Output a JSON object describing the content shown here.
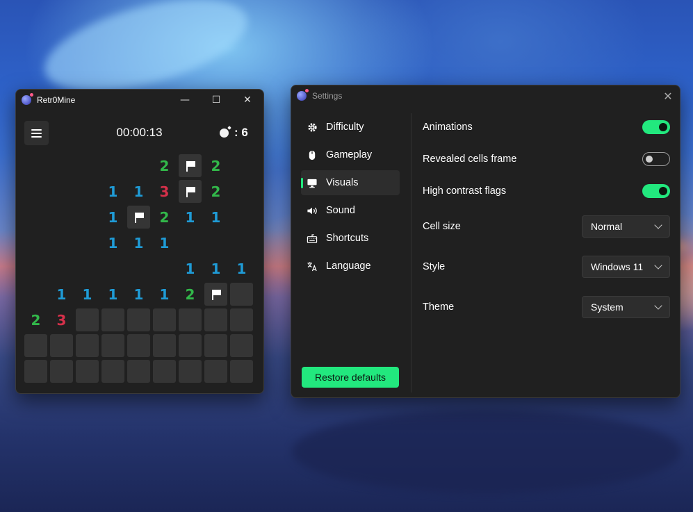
{
  "game_window": {
    "title": "Retr0Mine",
    "controls": {
      "minimize": "—",
      "maximize": "☐",
      "close": "✕"
    },
    "timer": "00:00:13",
    "mines_label": ": 6",
    "board": [
      [
        "",
        "",
        "",
        "",
        "",
        "2",
        "F",
        "2",
        ""
      ],
      [
        "",
        "",
        "",
        "1",
        "1",
        "3",
        "F",
        "2",
        ""
      ],
      [
        "",
        "",
        "",
        "1",
        "F",
        "2",
        "1",
        "1",
        ""
      ],
      [
        "",
        "",
        "",
        "1",
        "1",
        "1",
        "",
        "",
        ""
      ],
      [
        "",
        "",
        "",
        "",
        "",
        "",
        "1",
        "1",
        "1"
      ],
      [
        "",
        "1",
        "1",
        "1",
        "1",
        "1",
        "2",
        "F",
        "#"
      ],
      [
        "2",
        "3",
        "#",
        "#",
        "#",
        "#",
        "#",
        "#",
        "#"
      ],
      [
        "#",
        "#",
        "#",
        "#",
        "#",
        "#",
        "#",
        "#",
        "#"
      ],
      [
        "#",
        "#",
        "#",
        "#",
        "#",
        "#",
        "#",
        "#",
        "#"
      ]
    ]
  },
  "settings_window": {
    "title": "Settings",
    "close": "✕",
    "nav": [
      {
        "label": "Difficulty",
        "icon": "gear-icon"
      },
      {
        "label": "Gameplay",
        "icon": "mouse-icon"
      },
      {
        "label": "Visuals",
        "icon": "monitor-icon",
        "active": true
      },
      {
        "label": "Sound",
        "icon": "speaker-icon"
      },
      {
        "label": "Shortcuts",
        "icon": "keyboard-icon"
      },
      {
        "label": "Language",
        "icon": "translate-icon"
      }
    ],
    "restore_label": "Restore defaults",
    "options": {
      "animations": {
        "label": "Animations",
        "on": true
      },
      "revealed_frame": {
        "label": "Revealed cells frame",
        "on": false
      },
      "high_contrast": {
        "label": "High contrast flags",
        "on": true
      },
      "cell_size": {
        "label": "Cell size",
        "value": "Normal"
      },
      "style": {
        "label": "Style",
        "value": "Windows 11"
      },
      "theme": {
        "label": "Theme",
        "value": "System"
      }
    }
  },
  "colors": {
    "accent": "#22e87e",
    "one": "#1f9bd6",
    "two": "#32b84a",
    "three": "#d6304a"
  }
}
